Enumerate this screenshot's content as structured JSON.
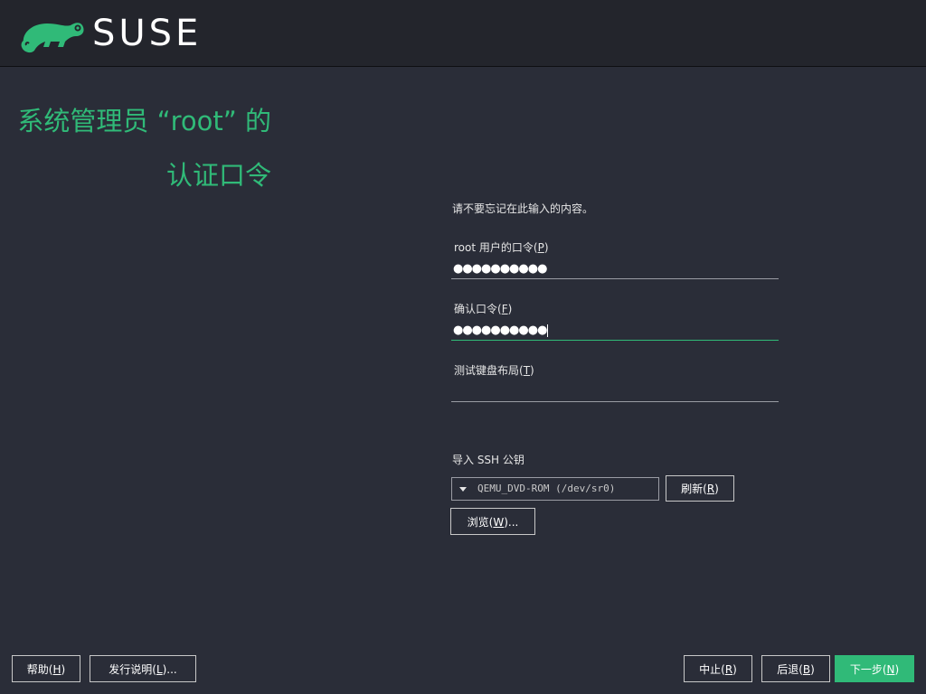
{
  "header": {
    "brand": "SUSE",
    "logo_icon": "suse-chameleon-icon",
    "accent": "#30ba78"
  },
  "page": {
    "title_line1": "系统管理员 “root” 的",
    "title_line2": "认证口令"
  },
  "form": {
    "note": "请不要忘记在此输入的内容。",
    "password_label_pre": "root 用户的口令(",
    "password_label_key": "P",
    "password_label_post": ")",
    "password_value": "●●●●●●●●●●",
    "confirm_label_pre": "确认口令(",
    "confirm_label_key": "F",
    "confirm_label_post": ")",
    "confirm_value": "●●●●●●●●●●",
    "keyboard_label_pre": "测试键盘布局(",
    "keyboard_label_key": "T",
    "keyboard_label_post": ")",
    "keyboard_value": "",
    "ssh_label": "导入 SSH 公钥",
    "ssh_device": "QEMU_DVD-ROM (/dev/sr0)",
    "refresh_pre": "刷新(",
    "refresh_key": "R",
    "refresh_post": ")",
    "browse_pre": "浏览(",
    "browse_key": "W",
    "browse_post": ")..."
  },
  "footer": {
    "help_pre": "帮助(",
    "help_key": "H",
    "help_post": ")",
    "release_pre": "发行说明(",
    "release_key": "L",
    "release_post": ")...",
    "abort_pre": "中止(",
    "abort_key": "R",
    "abort_post": ")",
    "back_pre": "后退(",
    "back_key": "B",
    "back_post": ")",
    "next_pre": "下一步(",
    "next_key": "N",
    "next_post": ")"
  }
}
